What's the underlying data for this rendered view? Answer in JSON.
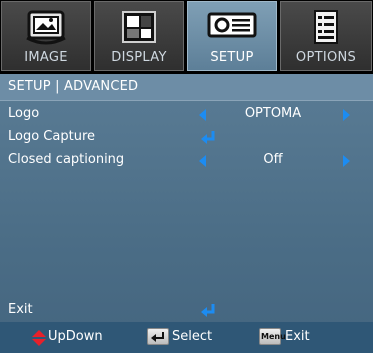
{
  "tabs": [
    {
      "label": "IMAGE",
      "icon": "image-icon",
      "active": false
    },
    {
      "label": "DISPLAY",
      "icon": "display-icon",
      "active": false
    },
    {
      "label": "SETUP",
      "icon": "setup-icon",
      "active": true
    },
    {
      "label": "OPTIONS",
      "icon": "options-icon",
      "active": false
    }
  ],
  "breadcrumb": "SETUP | ADVANCED",
  "rows": [
    {
      "label": "Logo",
      "value": "OPTOMA"
    },
    {
      "label": "Logo Capture"
    },
    {
      "label": "Closed captioning",
      "value": "Off"
    }
  ],
  "exit_label": "Exit",
  "footer": {
    "updown": "UpDown",
    "select": "Select",
    "menu_key": "Menu",
    "exit": "Exit"
  },
  "colors": {
    "accent_arrow": "#1c8cf2",
    "menu_bg": "#4b6d86",
    "footer_bg": "#2f5776",
    "active_tab": "#7f9fb5"
  }
}
